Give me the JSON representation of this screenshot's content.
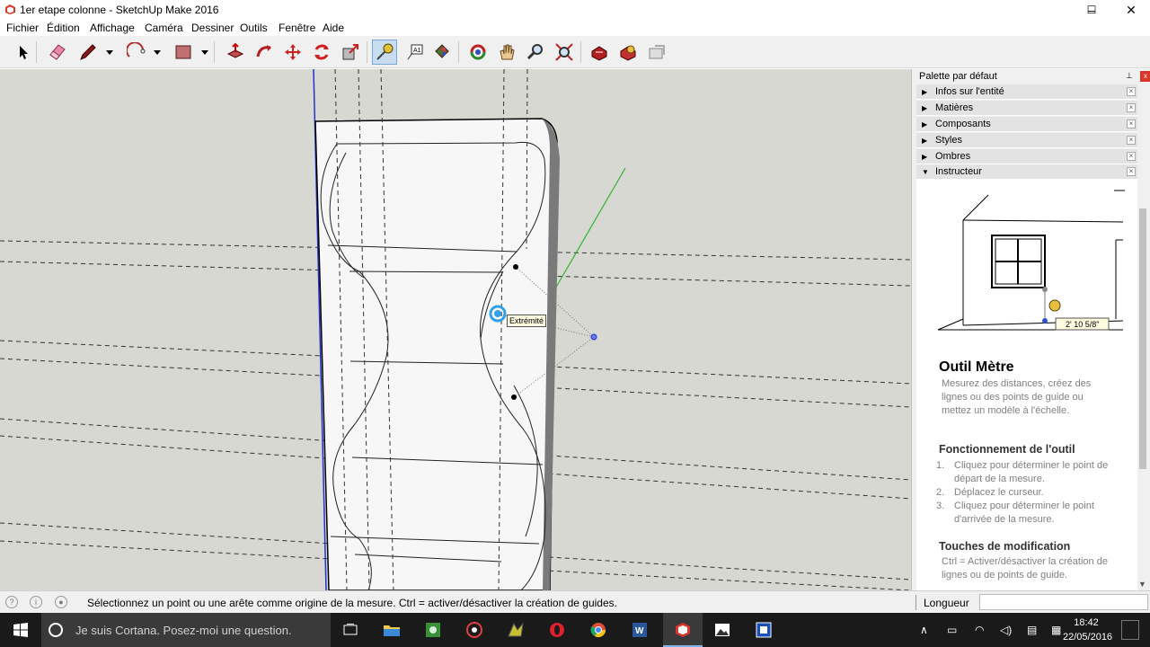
{
  "window": {
    "title": "1er etape colonne - SketchUp Make 2016",
    "app_icon": "sketchup-icon",
    "controls": {
      "minimize": "–",
      "maximize": "☐",
      "close": "✕"
    }
  },
  "menubar": {
    "items": [
      "Fichier",
      "Édition",
      "Affichage",
      "Caméra",
      "Dessiner",
      "Outils",
      "Fenêtre",
      "Aide"
    ]
  },
  "toolbar": {
    "tools": [
      "select-arrow-icon",
      "eraser-icon",
      "pencil-line-icon",
      "arc-icon",
      "rectangle-icon",
      "push-pull-icon",
      "follow-me-icon",
      "move-icon",
      "rotate-icon",
      "scale-icon",
      "tape-measure-icon",
      "text-icon",
      "paint-bucket-icon",
      "orbit-icon",
      "pan-icon",
      "zoom-icon",
      "zoom-extents-icon",
      "warehouse-icon",
      "extension-warehouse-icon",
      "send-to-layout-icon"
    ],
    "active_tool": "tape-measure-icon"
  },
  "viewport": {
    "inference_tooltip": "Extrémité",
    "axis_green_color": "#2db52d",
    "axis_blue_color": "#2233cc",
    "background": "#d8d8d3"
  },
  "tray": {
    "title": "Palette par défaut",
    "close_label": "x",
    "panels": [
      {
        "label": "Infos sur l'entité",
        "expanded": false
      },
      {
        "label": "Matières",
        "expanded": false
      },
      {
        "label": "Composants",
        "expanded": false
      },
      {
        "label": "Styles",
        "expanded": false
      },
      {
        "label": "Ombres",
        "expanded": false
      },
      {
        "label": "Instructeur",
        "expanded": true
      }
    ],
    "collapsed_marker": "▶",
    "expanded_marker": "▼",
    "panel_close": "×",
    "instructor": {
      "illustration_measure": "2' 10 5/8\"",
      "tool_title": "Outil Mètre",
      "tool_description": "Mesurez des distances, créez des lignes ou des points de guide ou mettez un modèle à l'échelle.",
      "operation_title": "Fonctionnement de l'outil",
      "steps": [
        {
          "num": "1.",
          "text": "Cliquez pour déterminer le point de départ de la mesure."
        },
        {
          "num": "2.",
          "text": "Déplacez le curseur."
        },
        {
          "num": "3.",
          "text": "Cliquez pour déterminer le point d'arrivée de la mesure."
        }
      ],
      "modifiers_title": "Touches de modification",
      "modifiers_description": "Ctrl = Activer/désactiver la création de lignes ou de points de guide."
    }
  },
  "statusbar": {
    "icons": [
      "geo-location-icon",
      "credits-icon",
      "user-icon"
    ],
    "message": "Sélectionnez un point ou une arête comme origine de la mesure.  Ctrl = activer/désactiver la création de guides.",
    "measurements_label": "Longueur",
    "measurements_value": ""
  },
  "taskbar": {
    "cortana_placeholder": "Je suis Cortana. Posez-moi une question.",
    "apps": [
      "task-view-icon",
      "file-explorer-icon",
      "app-green-icon",
      "media-player-icon",
      "app-yellow-icon",
      "opera-icon",
      "chrome-icon",
      "word-icon",
      "sketchup-taskbar-icon",
      "photos-icon",
      "app-blue-icon"
    ],
    "clock_time": "18:42",
    "clock_date": "22/05/2016"
  }
}
